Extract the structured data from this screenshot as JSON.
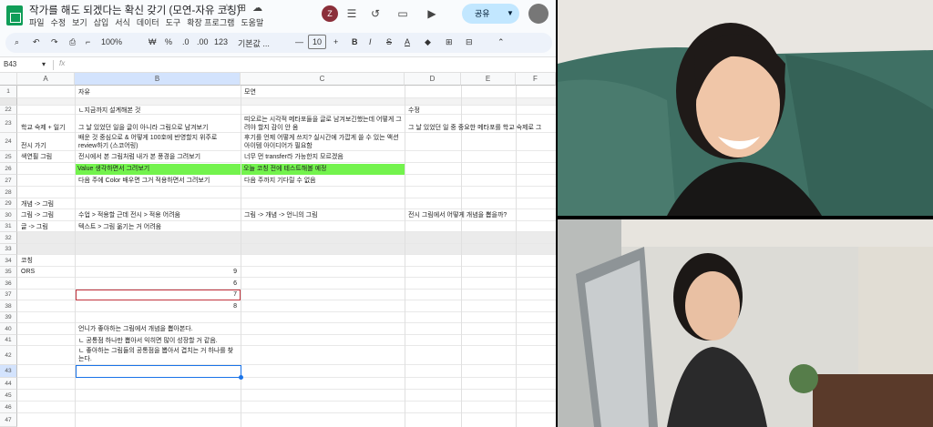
{
  "title": "작가를 해도 되겠다는 확신 갖기 (모연-자유 코칭)",
  "menu": [
    "파일",
    "수정",
    "보기",
    "삽입",
    "서식",
    "데이터",
    "도구",
    "확장 프로그램",
    "도움말"
  ],
  "avatar_letter": "Z",
  "share_label": "공유",
  "toolbar": {
    "zoom": "100%",
    "currency": "₩",
    "percent": "%",
    "decimals": ".0",
    "decimals2": ".00",
    "format_123": "123",
    "font": "기본값 ...",
    "font_size": "10",
    "bold": "B",
    "italic": "I",
    "strike": "S",
    "text_color": "A"
  },
  "name_box": "B43",
  "fx": "fx",
  "columns": [
    "A",
    "B",
    "C",
    "D",
    "E",
    "F"
  ],
  "row_numbers": {
    "r1": "1",
    "r22": "22",
    "r23": "23",
    "r24": "24",
    "r25": "25",
    "r26": "26",
    "r27": "27",
    "r28": "28",
    "r29": "29",
    "r30": "30",
    "r31": "31",
    "r32": "32",
    "r33": "33",
    "r34": "34",
    "r35": "35",
    "r36": "36",
    "r37": "37",
    "r38": "38",
    "r39": "39",
    "r40": "40",
    "r41": "41",
    "r42": "42",
    "r43": "43",
    "r44": "44",
    "r45": "45",
    "r46": "46",
    "r47": "47"
  },
  "cells": {
    "b1": "자유",
    "c1": "모연",
    "b22": "ㄴ지금까지 설계해본 것",
    "d22": "수정",
    "a23": "학교 숙제 + 일기",
    "b23": "그 날 있었던 일을 글이 아니라 그림으로 남겨보기",
    "c23": "띠오르는 시각적 메타포들을 글로 남겨보긴했는데 어떻게 그려야 할지 감이 안 옴",
    "d23": "그 날 있었던 일 중 중요한 메타포를 학교 숙제로 그",
    "a24": "전시 가기",
    "b24": "배운 것 중심으로 & 어떻게 100호에 반영할지 위주로 review하기 (스코어링)",
    "c24": "후기를 언제 어떻게 쓰지? 실시간에 가깝게 쓸 수 있는 액션 아이템 아이디어가 필요함",
    "a25": "색연필 그림",
    "b25": "전시에서 본 그림처럼 내가 본 풍경을 그려보기",
    "c25": "너무 먼 transfer라 가능한지 모르겠음",
    "b26": "Value 생각하면서 그려보기",
    "c26": "오늘 코칭 전에 테스트해볼 예정",
    "b27": "다음 주에 Color 배우면 그거 적용하면서 그려보기",
    "c27": "다음 주까지 기다릴 수 없음",
    "a29": "개념 -> 그림",
    "a30": "그림 -> 그림",
    "b30": "수업 > 적용할 근데 전시 > 적용 어려움",
    "c30": "그림 -> 개념 -> 언니의 그림",
    "d30": "전시 그림에서 어떻게 개념을 뽑을까?",
    "a31": "글 -> 그림",
    "b31": "텍스트 > 그림 옮기는 거 어려움",
    "a34": "코칭",
    "a35": "ORS",
    "b35": "9",
    "b36": "6",
    "b37": "7",
    "b38": "8",
    "b40": "언니가 좋아하는 그림에서 개념을 뽑아본다.",
    "b41": "ㄴ 공통점 하나만 뽑아서 익히면 많이 성장할 거 같음.",
    "b42": "ㄴ 좋아하는 그림들의 공통점을 뽑아서 겹치는 거 하나를 찾는다."
  },
  "colors": {
    "highlight": "#73f34d",
    "selection": "#1a73e8",
    "error_border": "#c2333e",
    "share_bg": "#c2e7ff"
  }
}
